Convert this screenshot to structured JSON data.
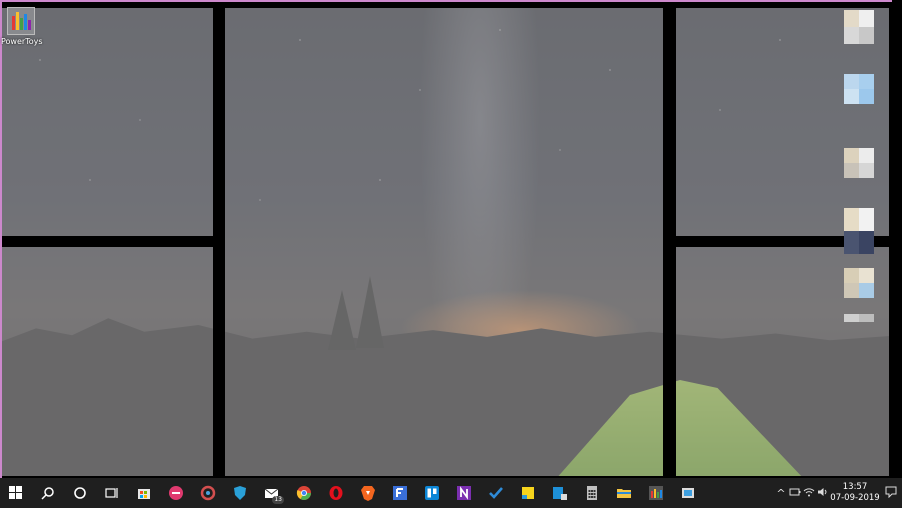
{
  "desktop": {
    "icons": [
      {
        "label": "PowerToys"
      }
    ]
  },
  "taskbar": {
    "start": "start-icon",
    "search": "search-icon",
    "cortana": "cortana-icon",
    "task_view": "task-view-icon",
    "apps": [
      {
        "name": "microsoft-store-icon",
        "color": "#e8e8e8"
      },
      {
        "name": "app-icon-pink",
        "color": "#e03a6f"
      },
      {
        "name": "app-icon-colorful",
        "color": "#d34f4f"
      },
      {
        "name": "shield-app-icon",
        "color": "#2aa0d8"
      },
      {
        "name": "mail-icon",
        "color": "#ffffff",
        "badge": "13"
      },
      {
        "name": "chrome-icon",
        "color": "#4caf50"
      },
      {
        "name": "opera-icon",
        "color": "#e3101d"
      },
      {
        "name": "brave-icon",
        "color": "#f4661f"
      },
      {
        "name": "app-icon-f",
        "color": "#3a6fd8"
      },
      {
        "name": "trello-icon",
        "color": "#0c86d6"
      },
      {
        "name": "onenote-icon",
        "color": "#7b2fb0"
      },
      {
        "name": "todo-icon",
        "color": "#2e8bd8"
      },
      {
        "name": "sticky-notes-icon",
        "color": "#f7d51d"
      },
      {
        "name": "desktop-app-icon",
        "color": "#1e90d8"
      },
      {
        "name": "calculator-icon",
        "color": "#c0c0c0"
      },
      {
        "name": "file-explorer-icon",
        "color": "#f4c542"
      },
      {
        "name": "powertoys-icon",
        "color": "#6e6e6e"
      },
      {
        "name": "app-icon-blue",
        "color": "#3fa0e0"
      }
    ],
    "tray": {
      "clock_time": "13:57",
      "clock_date": "07-09-2019"
    }
  },
  "colors": {
    "zone_border": "#000000",
    "zone_fill": "#a0a0a0",
    "taskbar": "#1f1f1f"
  }
}
